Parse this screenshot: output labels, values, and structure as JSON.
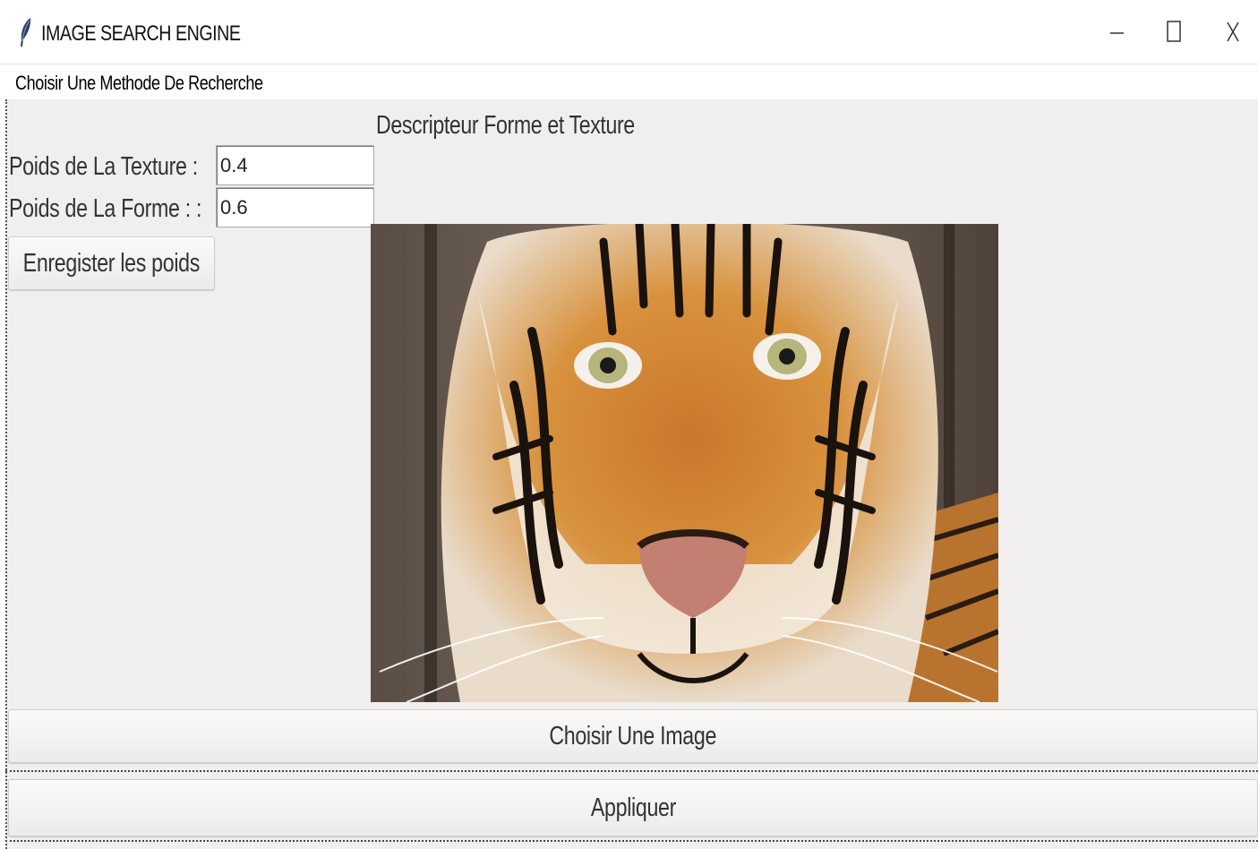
{
  "window": {
    "title": "IMAGE SEARCH ENGINE",
    "controls": {
      "minimize": "–",
      "maximize": "☐",
      "close": "X"
    }
  },
  "menubar": {
    "items": [
      {
        "label": "Choisir Une Methode De Recherche"
      }
    ]
  },
  "main": {
    "descriptor_title": "Descripteur Forme et Texture",
    "fields": {
      "texture": {
        "label": "Poids de La Texture :",
        "value": "0.4"
      },
      "forme": {
        "label": "Poids de La Forme : :",
        "value": "0.6"
      }
    },
    "save_button": "Enregister les poids",
    "choose_image_button": "Choisir Une Image",
    "apply_button": "Appliquer"
  },
  "icons": {
    "app": "feather-icon",
    "minimize": "minimize-icon",
    "maximize": "maximize-icon",
    "close": "close-icon"
  },
  "colors": {
    "background": "#f1efed",
    "button": "#eeedeb",
    "text": "#333333"
  }
}
